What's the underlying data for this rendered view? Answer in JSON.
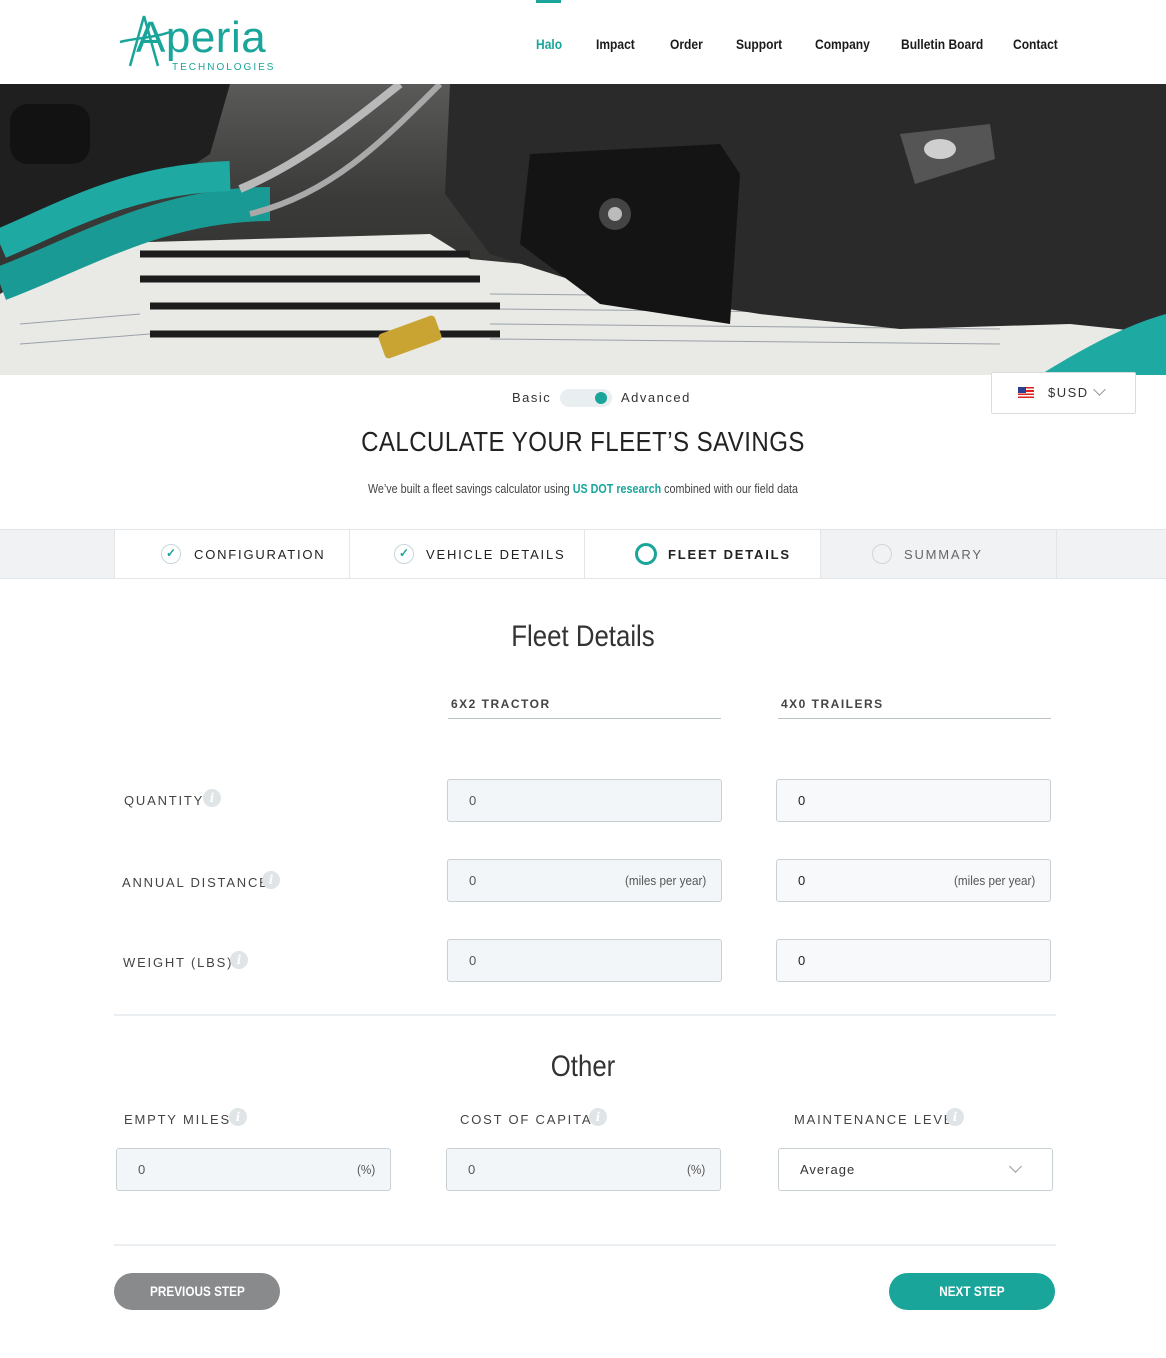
{
  "brand": {
    "name": "Aperia",
    "sub": "TECHNOLOGIES",
    "accent": "#1aa59a"
  },
  "nav": {
    "items": [
      "Halo",
      "Impact",
      "Order",
      "Support",
      "Company",
      "Bulletin Board",
      "Contact"
    ],
    "active": "Halo"
  },
  "hero": {
    "icon": "hero-photo-tire-inflator"
  },
  "mode": {
    "basic": "Basic",
    "advanced": "Advanced",
    "selected": "Advanced"
  },
  "currency": {
    "label": "$USD",
    "flag": "us-flag-icon"
  },
  "header": {
    "title": "CALCULATE YOUR FLEET’S SAVINGS",
    "sub_pre": "We’ve built a fleet savings calculator using ",
    "sub_link": "US DOT research",
    "sub_post": " combined with our field data"
  },
  "steps": [
    {
      "label": "CONFIGURATION",
      "state": "done",
      "check": "✓"
    },
    {
      "label": "VEHICLE DETAILS",
      "state": "done",
      "check": "✓"
    },
    {
      "label": "FLEET DETAILS",
      "state": "current"
    },
    {
      "label": "SUMMARY",
      "state": "todo"
    }
  ],
  "fleet": {
    "title": "Fleet Details",
    "columns": [
      "6X2 TRACTOR",
      "4X0 TRAILERS"
    ],
    "rows": [
      {
        "label": "QUANTITY",
        "values": [
          "0",
          "0"
        ],
        "unit": ""
      },
      {
        "label": "ANNUAL DISTANCE",
        "values": [
          "0",
          "0"
        ],
        "unit": "(miles per year)"
      },
      {
        "label": "WEIGHT (LBS)",
        "values": [
          "0",
          "0"
        ],
        "unit": ""
      }
    ],
    "info": "i"
  },
  "other": {
    "title": "Other",
    "empty_miles": {
      "label": "EMPTY MILES",
      "value": "0",
      "unit": "(%)"
    },
    "cost_of_capital": {
      "label": "COST OF CAPITAL",
      "value": "0",
      "unit": "(%)"
    },
    "maintenance": {
      "label": "MAINTENANCE LEVEL",
      "value": "Average"
    }
  },
  "buttons": {
    "prev": "PREVIOUS STEP",
    "next": "NEXT STEP"
  }
}
